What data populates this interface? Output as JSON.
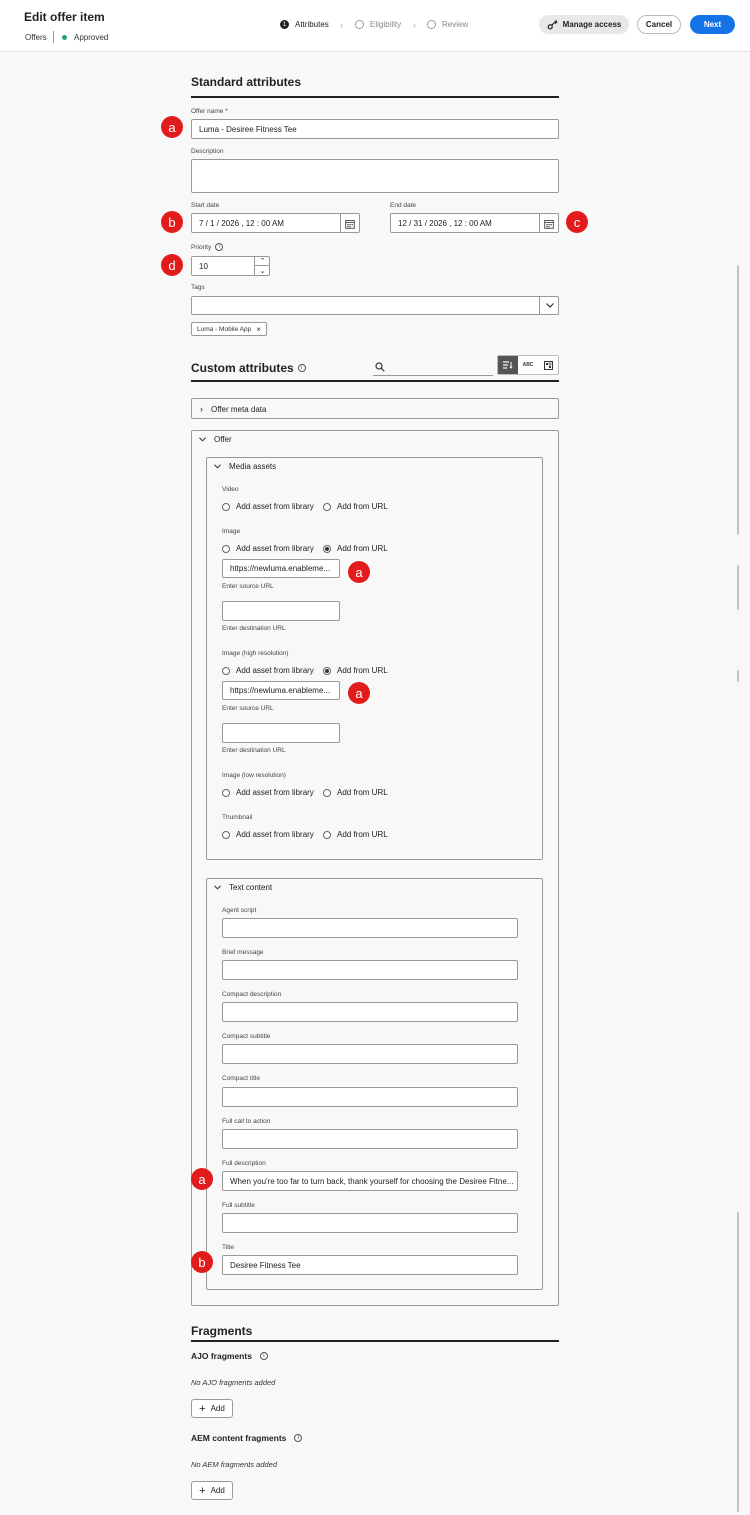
{
  "header": {
    "title": "Edit offer item",
    "breadcrumb": "Offers",
    "status": "Approved",
    "steps": [
      {
        "number": "1",
        "label": "Attributes"
      },
      {
        "label": "Eligibility"
      },
      {
        "label": "Review"
      }
    ],
    "manage_access": "Manage access",
    "cancel": "Cancel",
    "next": "Next"
  },
  "standard": {
    "title": "Standard attributes",
    "offer_name_label": "Offer name",
    "offer_name_required": "*",
    "offer_name_value": "Luma - Desiree Fitness Tee",
    "description_label": "Description",
    "start_label": "Start date",
    "start_value": "7 / 1 / 2026 , 12 : 00   AM",
    "end_label": "End date",
    "end_value": "12 / 31 / 2026 , 12 : 00   AM",
    "priority_label": "Priority",
    "priority_value": "10",
    "tags_label": "Tags",
    "tag_chip": "Luma - Mobile App"
  },
  "custom": {
    "title": "Custom attributes",
    "view_abc": "ABC",
    "offer_meta": "Offer meta data",
    "offer": "Offer",
    "media_assets": "Media assets",
    "add_library": "Add asset from library",
    "add_url": "Add from URL",
    "video_label": "Video",
    "image_label": "Image",
    "image_url": "https://newluma.enableme...",
    "enter_source": "Enter source URL",
    "enter_dest": "Enter destination URL",
    "image_hi_label": "Image (high resolution)",
    "image_hi_url": "https://newluma.enableme...",
    "image_lo_label": "Image (low resolution)",
    "thumbnail_label": "Thumbnail",
    "text_content": "Text content",
    "agent_script": "Agent script",
    "brief_message": "Brief message",
    "compact_description": "Compact description",
    "compact_subtitle": "Compact subtitle",
    "compact_title": "Compact title",
    "full_cta": "Full call to action",
    "full_description": "Full description",
    "full_description_value": "When you're too far to turn back, thank yourself for choosing the Desiree Fitne...",
    "full_subtitle": "Full subtitle",
    "title_label": "Title",
    "title_value": "Desiree Fitness Tee"
  },
  "fragments": {
    "title": "Fragments",
    "ajo_title": "AJO fragments",
    "ajo_empty": "No AJO fragments added",
    "aem_title": "AEM content fragments",
    "aem_empty": "No AEM fragments added",
    "add": "Add"
  },
  "markers": {
    "a": "a",
    "b": "b",
    "c": "c",
    "d": "d"
  },
  "colors": {
    "accent": "#1473e6",
    "marker": "#e21c1c",
    "approved": "#2d9d78"
  }
}
